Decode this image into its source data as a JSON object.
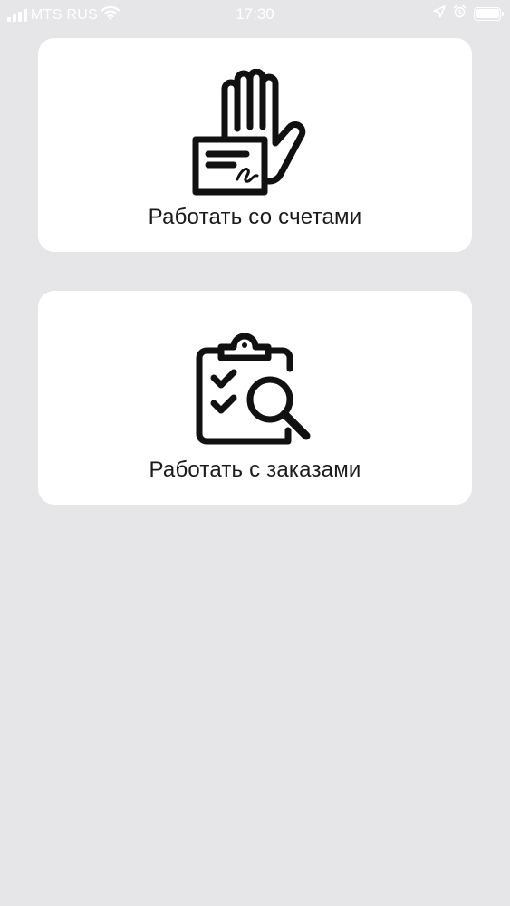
{
  "status_bar": {
    "carrier": "MTS RUS",
    "time": "17:30",
    "signal_bars": 4,
    "battery_level": 1.0,
    "icons": [
      "signal-icon",
      "wifi-icon",
      "location-arrow-icon",
      "alarm-icon",
      "battery-icon"
    ]
  },
  "menu": {
    "items": [
      {
        "label": "Работать со счетами",
        "icon": "hand-invoice-icon"
      },
      {
        "label": "Работать с заказами",
        "icon": "clipboard-search-icon"
      }
    ]
  },
  "colors": {
    "background": "#e6e5e7",
    "card": "#ffffff",
    "text": "#1b1b1b",
    "icon": "#111111"
  }
}
